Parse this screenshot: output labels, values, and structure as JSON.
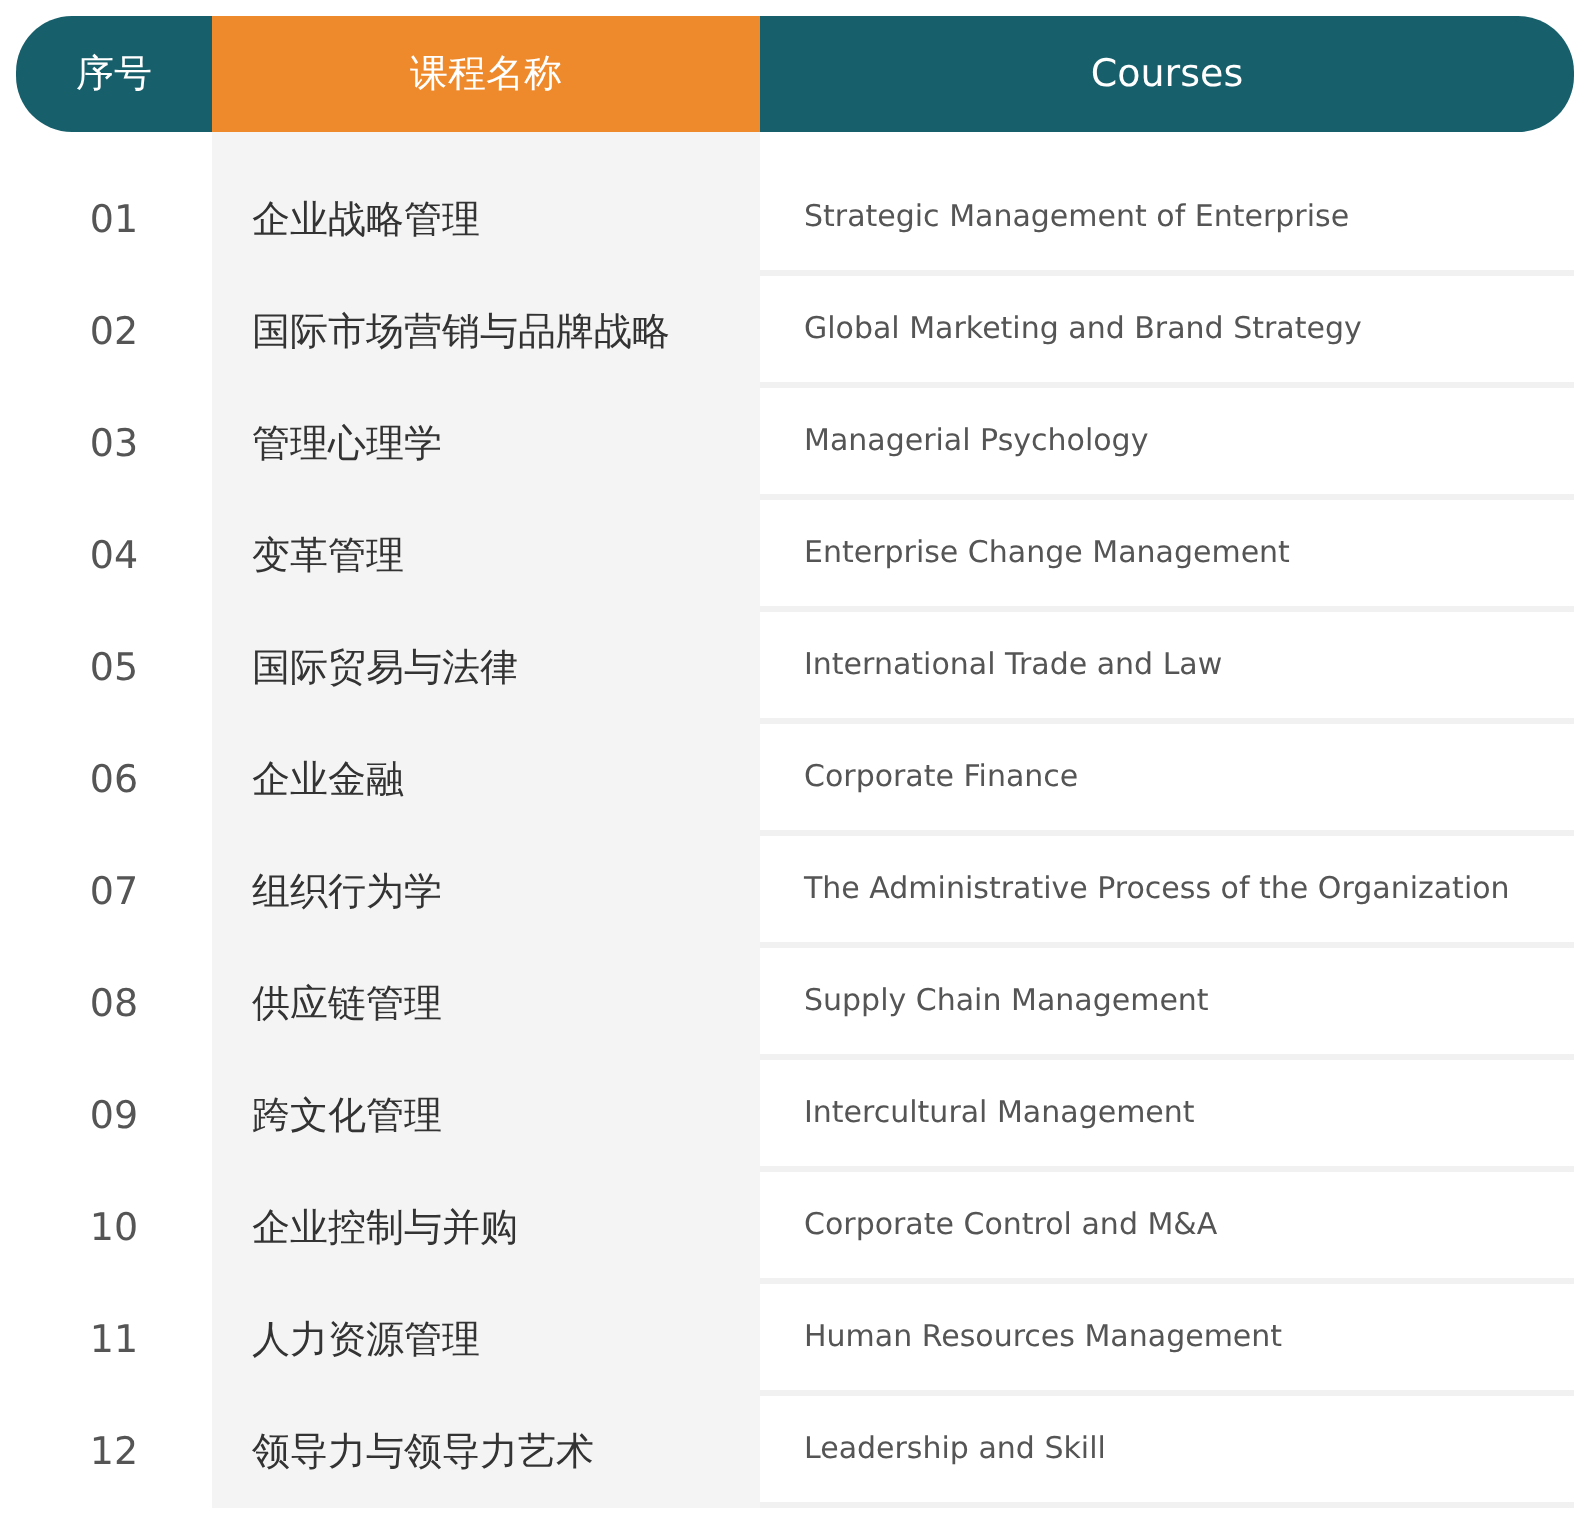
{
  "table": {
    "columns": [
      "序号",
      "课程名称",
      "Courses"
    ],
    "rows": [
      {
        "index": "01",
        "name": "企业战略管理",
        "english": "Strategic Management of Enterprise"
      },
      {
        "index": "02",
        "name": "国际市场营销与品牌战略",
        "english": "Global Marketing and Brand Strategy"
      },
      {
        "index": "03",
        "name": "管理心理学",
        "english": "Managerial Psychology"
      },
      {
        "index": "04",
        "name": "变革管理",
        "english": "Enterprise Change Management"
      },
      {
        "index": "05",
        "name": "国际贸易与法律",
        "english": "International Trade and Law"
      },
      {
        "index": "06",
        "name": "企业金融",
        "english": "Corporate Finance"
      },
      {
        "index": "07",
        "name": "组织行为学",
        "english": "The Administrative Process of the Organization"
      },
      {
        "index": "08",
        "name": "供应链管理",
        "english": "Supply Chain Management"
      },
      {
        "index": "09",
        "name": "跨文化管理",
        "english": "Intercultural Management"
      },
      {
        "index": "10",
        "name": "企业控制与并购",
        "english": "Corporate Control and M&A"
      },
      {
        "index": "11",
        "name": "人力资源管理",
        "english": "Human Resources Management"
      },
      {
        "index": "12",
        "name": "领导力与领导力艺术",
        "english": "Leadership and Skill"
      }
    ]
  }
}
